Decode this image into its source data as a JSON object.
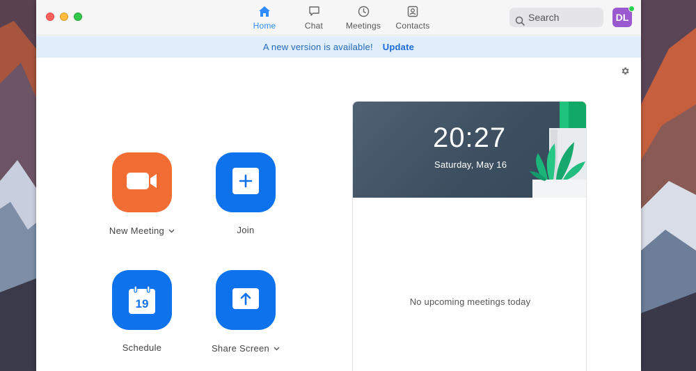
{
  "titlebar": {
    "tabs": [
      {
        "label": "Home",
        "icon": "home-icon",
        "active": true
      },
      {
        "label": "Chat",
        "icon": "chat-icon",
        "active": false
      },
      {
        "label": "Meetings",
        "icon": "clock-icon",
        "active": false
      },
      {
        "label": "Contacts",
        "icon": "contacts-icon",
        "active": false
      }
    ],
    "search_placeholder": "Search",
    "avatar_initials": "DL",
    "avatar_color": "#9b59d0",
    "presence_color": "#27d14b"
  },
  "banner": {
    "message": "A new version is available!",
    "action_label": "Update"
  },
  "actions": [
    {
      "label": "New Meeting",
      "icon": "video-camera-icon",
      "color": "#f26d34",
      "has_dropdown": true
    },
    {
      "label": "Join",
      "icon": "plus-icon",
      "color": "#0e72ed",
      "has_dropdown": false
    },
    {
      "label": "Schedule",
      "icon": "calendar-icon",
      "calendar_day": "19",
      "color": "#0e72ed",
      "has_dropdown": false
    },
    {
      "label": "Share Screen",
      "icon": "share-arrow-icon",
      "color": "#0e72ed",
      "has_dropdown": true
    }
  ],
  "clock_card": {
    "time": "20:27",
    "date": "Saturday, May 16"
  },
  "meetings_panel": {
    "empty_message": "No upcoming meetings today"
  },
  "colors": {
    "accent": "#2d8cff",
    "banner_bg": "#e0eefc"
  }
}
